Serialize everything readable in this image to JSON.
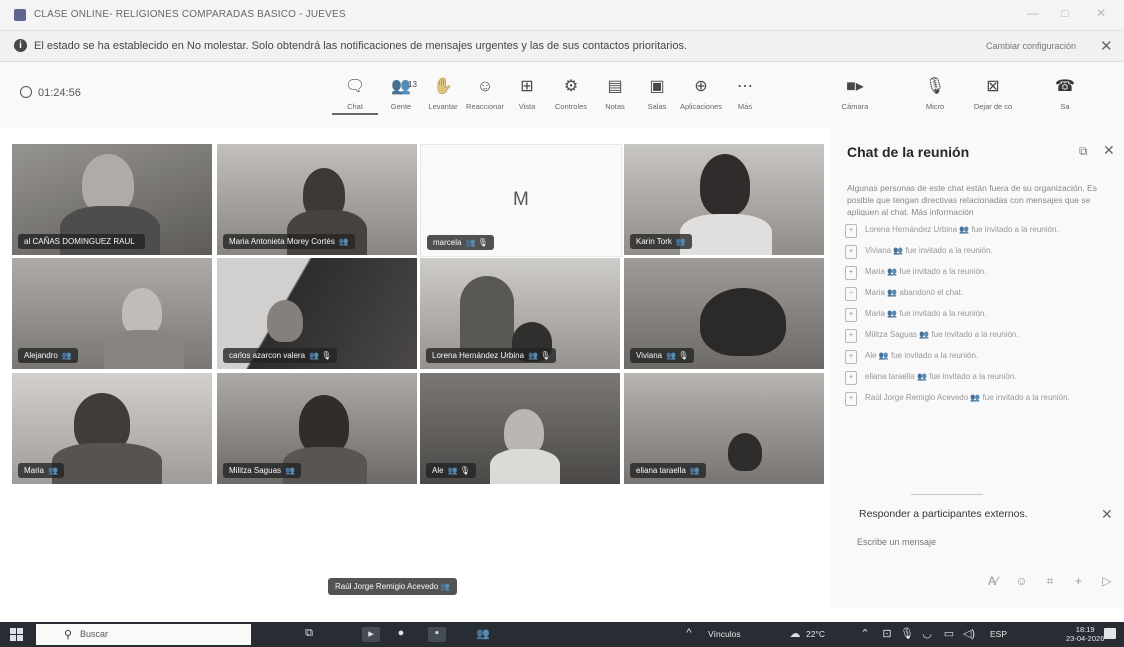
{
  "window": {
    "title": "CLASE ONLINE- RELIGIONES COMPARADAS BASICO - JUEVES"
  },
  "notification": {
    "message": "El estado se ha establecido en No molestar. Solo obtendrá las notificaciones de mensajes urgentes y las de sus contactos prioritarios.",
    "change_settings": "Cambiar configuración"
  },
  "toolbar": {
    "timer": "01:24:56",
    "buttons": [
      {
        "label": "Chat",
        "icon": "chat-icon"
      },
      {
        "label": "Gente",
        "icon": "people-icon",
        "count": "13"
      },
      {
        "label": "Levantar",
        "icon": "raise-hand-icon"
      },
      {
        "label": "Reaccionar",
        "icon": "reaction-icon"
      },
      {
        "label": "Vista",
        "icon": "view-icon"
      },
      {
        "label": "Controles",
        "icon": "controls-icon"
      },
      {
        "label": "Notas",
        "icon": "notes-icon"
      },
      {
        "label": "Salas",
        "icon": "rooms-icon"
      },
      {
        "label": "Aplicaciones",
        "icon": "apps-icon"
      },
      {
        "label": "Más",
        "icon": "more-icon"
      }
    ],
    "camera": "Cámara",
    "mic": "Micro",
    "share": "Dejar de co",
    "leave": "Sa"
  },
  "participants": [
    {
      "name": "al CAÑAS DOMINGUEZ RAUL",
      "badge": ""
    },
    {
      "name": "Maria Antonieta Morey Cortés",
      "badge": "👥"
    },
    {
      "name": "marcela",
      "badge": "👥 🎙",
      "initial": "M"
    },
    {
      "name": "Karin Tork",
      "badge": "👥"
    },
    {
      "name": "Alejandro",
      "badge": "👥"
    },
    {
      "name": "carlos azarcon valera",
      "badge": "👥 🎙"
    },
    {
      "name": "Lorena Hernández Urbina",
      "badge": "👥 🎙"
    },
    {
      "name": "Viviana",
      "badge": "👥 🎙"
    },
    {
      "name": "Maria",
      "badge": "👥"
    },
    {
      "name": "Militza Saguas",
      "badge": "👥"
    },
    {
      "name": "Ale",
      "badge": "👥 🎙"
    },
    {
      "name": "eliana taraella",
      "badge": "👥"
    }
  ],
  "floating_name": "Raúl Jorge Remigio Acevedo 👥",
  "chat": {
    "title": "Chat de la reunión",
    "warning": "Algunas personas de este chat están fuera de su organización. Es posible que tengan directivas relacionadas con mensajes que se apliquen al chat. Más información",
    "messages": [
      "Lorena Hernández Urbina 👥 fue invitado a la reunión.",
      "Viviana 👥 fue invitado a la reunión.",
      "Maria 👥 fue invitado a la reunión.",
      "Maria 👥 abandonó el chat.",
      "Maria 👥 fue invitado a la reunión.",
      "Militza Saguas 👥 fue invitado a la reunión.",
      "Ale 👥 fue invitado a la reunión.",
      "eliana taraella 👥 fue invitado a la reunión.",
      "Raúl Jorge Remigio Acevedo 👥 fue invitado a la reunión."
    ],
    "reply_label": "Responder a participantes externos.",
    "compose_placeholder": "Escribe un mensaje"
  },
  "taskbar": {
    "search_placeholder": "Buscar",
    "links": "Vínculos",
    "weather": "22°C",
    "language": "ESP",
    "time": "18:19",
    "date": "23-04-2026"
  }
}
